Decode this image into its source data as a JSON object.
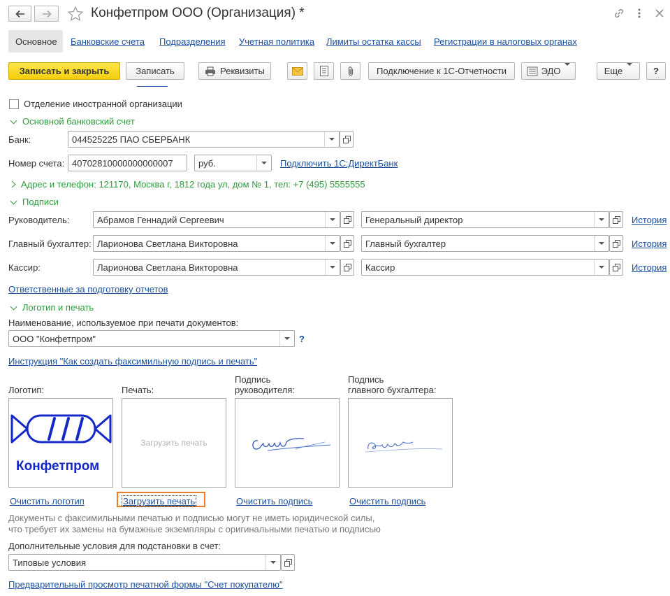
{
  "window": {
    "title": "Конфетпром ООО (Организация) *"
  },
  "icons": {
    "back": "arrow-left-icon",
    "forward": "arrow-right-icon",
    "favorite": "star-icon",
    "link": "link-icon",
    "menu": "kebab-menu-icon",
    "close": "close-icon",
    "print": "printer-icon",
    "mail": "envelope-icon",
    "document": "document-icon",
    "attach": "paperclip-icon",
    "edo": "edo-icon"
  },
  "tabs": [
    {
      "label": "Основное"
    },
    {
      "label": "Банковские счета"
    },
    {
      "label": "Подразделения"
    },
    {
      "label": "Учетная политика"
    },
    {
      "label": "Лимиты остатка кассы"
    },
    {
      "label": "Регистрации в налоговых органах"
    }
  ],
  "toolbar": {
    "save_close": "Записать и закрыть",
    "save": "Записать",
    "requisites": "Реквизиты",
    "connect": "Подключение к 1С-Отчетности",
    "edo": "ЭДО",
    "more": "Еще",
    "help": "?"
  },
  "form": {
    "foreign_branch": "Отделение иностранной организации",
    "bank_section": "Основной банковский счет",
    "bank_label": "Банк:",
    "bank_value": "044525225 ПАО СБЕРБАНК",
    "account_label": "Номер счета:",
    "account_value": "40702810000000000007",
    "currency_value": "руб.",
    "directbank_link": "Подключить 1С:ДиректБанк",
    "address_section": "Адрес и телефон: 121170, Москва г, 1812 года ул, дом № 1, тел: +7 (495) 5555555",
    "signatures_section": "Подписи",
    "history_link": "История",
    "signers": [
      {
        "label": "Руководитель:",
        "name": "Абрамов Геннадий Сергеевич",
        "position": "Генеральный директор"
      },
      {
        "label": "Главный бухгалтер:",
        "name": "Ларионова Светлана Викторовна",
        "position": "Главный бухгалтер"
      },
      {
        "label": "Кассир:",
        "name": "Ларионова Светлана Викторовна",
        "position": "Кассир"
      }
    ],
    "responsible_link": "Ответственные за подготовку отчетов",
    "logo_section": "Логотип и печать",
    "print_name_label": "Наименование, используемое при печати документов:",
    "print_name_value": "ООО \"Конфетпром\"",
    "help_mark": "?",
    "instruction_link": "Инструкция \"Как создать факсимильную подпись и печать\"",
    "logo_label": "Логотип:",
    "stamp_label": "Печать:",
    "head_sign_label_1": "Подпись",
    "head_sign_label_2": "руководителя:",
    "acc_sign_label_1": "Подпись",
    "acc_sign_label_2": "главного бухгалтера:",
    "logo_text": "Конфетпром",
    "stamp_placeholder": "Загрузить печать",
    "clear_logo": "Очистить логотип",
    "load_stamp": "Загрузить печать",
    "clear_sign_1": "Очистить подпись",
    "clear_sign_2": "Очистить подпись",
    "warning_1": "Документы с факсимильными печатью и подписью могут не иметь юридической силы,",
    "warning_2": "что требует их замены на бумажные экземпляры с оригинальными печатью и подписью",
    "conditions_label": "Дополнительные условия для подстановки в счет:",
    "conditions_value": "Типовые условия",
    "preview_link": "Предварительный просмотр печатной формы \"Счет покупателю\""
  },
  "colors": {
    "primary_button": "#f4cf0c",
    "section_green": "#2e9b3e",
    "link_blue": "#1a4f9c",
    "highlight_orange": "#ee7d2b",
    "logo_blue": "#1428c8"
  }
}
